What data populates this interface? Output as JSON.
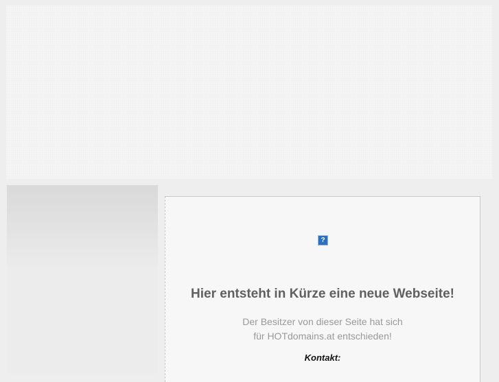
{
  "content": {
    "image_icon": "broken-image-icon",
    "headline": "Hier entsteht in Kürze eine neue Webseite!",
    "sub_line1": "Der Besitzer von dieser Seite hat sich",
    "sub_line2": "für HOTdomains.at entschieden!",
    "contact_label": "Kontakt:"
  }
}
